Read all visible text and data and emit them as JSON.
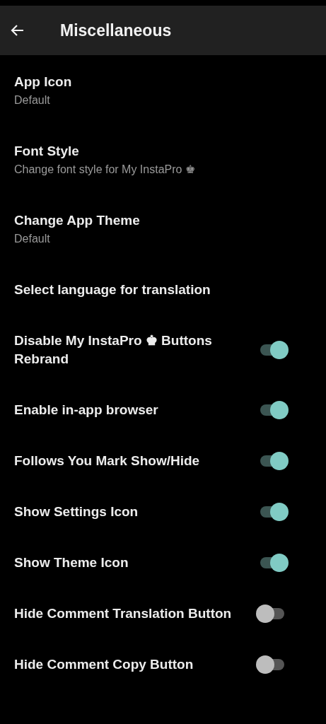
{
  "app_bar": {
    "title": "Miscellaneous"
  },
  "items": [
    {
      "kind": "nav",
      "title": "App Icon",
      "subtitle": "Default"
    },
    {
      "kind": "nav",
      "title": "Font Style",
      "subtitle": "Change font style for My InstaPro ♚"
    },
    {
      "kind": "nav",
      "title": "Change App Theme",
      "subtitle": "Default"
    },
    {
      "kind": "nav",
      "title": "Select language for translation"
    },
    {
      "kind": "switch",
      "title": "Disable My InstaPro ♚ Buttons Rebrand",
      "on": true
    },
    {
      "kind": "switch",
      "title": "Enable in-app browser",
      "on": true
    },
    {
      "kind": "switch",
      "title": "Follows You Mark Show/Hide",
      "on": true
    },
    {
      "kind": "switch",
      "title": "Show Settings Icon",
      "on": true
    },
    {
      "kind": "switch",
      "title": "Show Theme Icon",
      "on": true
    },
    {
      "kind": "switch",
      "title": "Hide Comment Translation Button",
      "on": false
    },
    {
      "kind": "switch",
      "title": "Hide Comment Copy Button",
      "on": false
    }
  ]
}
